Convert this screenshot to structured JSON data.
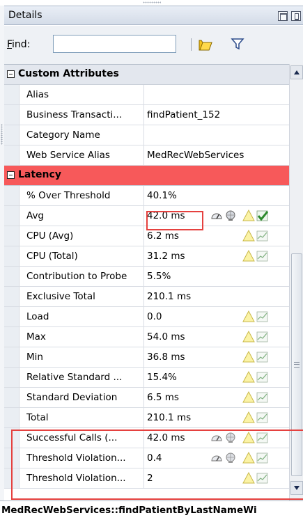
{
  "panel": {
    "title": "Details"
  },
  "find": {
    "label_accel": "F",
    "label_rest": "ind:",
    "value": ""
  },
  "groups": {
    "custom": {
      "header": "Custom Attributes"
    },
    "latency": {
      "header": "Latency"
    }
  },
  "custom_rows": [
    {
      "name": "Alias",
      "value": ""
    },
    {
      "name": "Business Transacti...",
      "value": "findPatient_152"
    },
    {
      "name": "Category Name",
      "value": ""
    },
    {
      "name": "Web Service Alias",
      "value": "MedRecWebServices"
    }
  ],
  "latency_rows": [
    {
      "name": "% Over Threshold",
      "value": "40.1%"
    },
    {
      "name": "Avg",
      "value": "42.0 ms"
    },
    {
      "name": "CPU (Avg)",
      "value": "6.2 ms"
    },
    {
      "name": "CPU (Total)",
      "value": "31.2 ms"
    },
    {
      "name": "Contribution to Probe",
      "value": "5.5%"
    },
    {
      "name": "Exclusive Total",
      "value": "210.1 ms"
    },
    {
      "name": "Load",
      "value": "0.0"
    },
    {
      "name": "Max",
      "value": "54.0 ms"
    },
    {
      "name": "Min",
      "value": "36.8 ms"
    },
    {
      "name": "Relative Standard ...",
      "value": "15.4%"
    },
    {
      "name": "Standard Deviation",
      "value": "6.5 ms"
    },
    {
      "name": "Total",
      "value": "210.1 ms"
    },
    {
      "name": "Successful Calls (...",
      "value": "42.0 ms"
    },
    {
      "name": "Threshold Violation...",
      "value": "0.4"
    },
    {
      "name": "Threshold Violation...",
      "value": "2"
    }
  ],
  "footer": {
    "text": "MedRecWebServices::findPatientByLastNameWi"
  },
  "icons": [
    "gauge-icon",
    "globe-icon",
    "warning-icon",
    "trend-icon",
    "check-icon",
    "folder-icon",
    "filter-icon"
  ],
  "colors": {
    "latency_header": "#f7595a",
    "highlight": "#e5413f",
    "group_header": "#e3e7ee"
  }
}
